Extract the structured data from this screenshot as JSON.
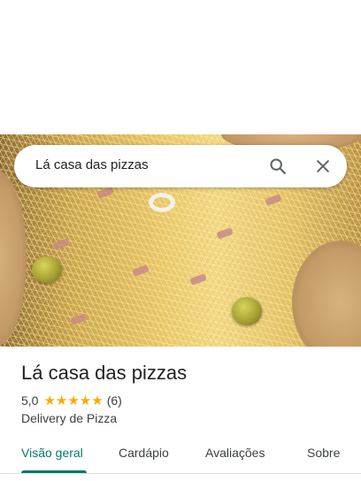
{
  "search": {
    "query": "Lá casa das pizzas"
  },
  "place": {
    "name": "Lá casa das pizzas",
    "rating": "5,0",
    "stars": "★★★★★",
    "review_count": "(6)",
    "category": "Delivery de Pizza"
  },
  "tabs": [
    {
      "label": "Visão geral",
      "active": true
    },
    {
      "label": "Cardápio",
      "active": false
    },
    {
      "label": "Avaliações",
      "active": false
    },
    {
      "label": "Sobre",
      "active": false
    }
  ],
  "colors": {
    "accent": "#00796b",
    "star": "#f9ab00"
  },
  "icons": [
    "search-icon",
    "close-icon"
  ]
}
